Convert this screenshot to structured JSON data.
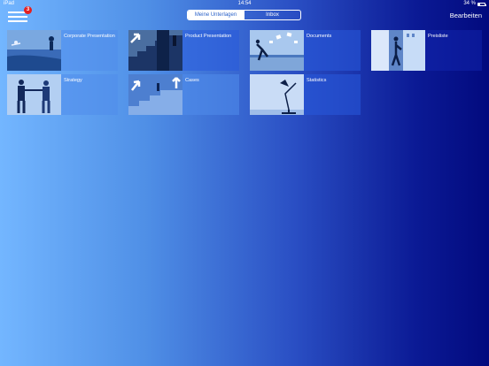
{
  "status": {
    "device": "iPad",
    "time": "14:54",
    "battery": "34 %",
    "battery_level": 0.34
  },
  "header": {
    "menu_badge": "3",
    "tabs": [
      {
        "label": "Meine Unterlagen",
        "active": true
      },
      {
        "label": "Inbox",
        "active": false
      }
    ],
    "edit_label": "Bearbeiten"
  },
  "tiles": [
    {
      "label": "Corporate Presentation",
      "icon": "people-on-beach-photo"
    },
    {
      "label": "Product Presentation",
      "icon": "arrow-stairs-photo"
    },
    {
      "label": "Documents",
      "icon": "jumping-man-papers-photo"
    },
    {
      "label": "Preisliste",
      "icon": "door-man-photo"
    },
    {
      "label": "Strategy",
      "icon": "handshake-photo"
    },
    {
      "label": "Cases",
      "icon": "arrows-steps-photo"
    },
    {
      "label": "Statistics",
      "icon": "desk-lamp-photo"
    }
  ],
  "colors": {
    "background_left": "#73b6ff",
    "background_right": "#020a7e",
    "badge": "#e62020"
  }
}
